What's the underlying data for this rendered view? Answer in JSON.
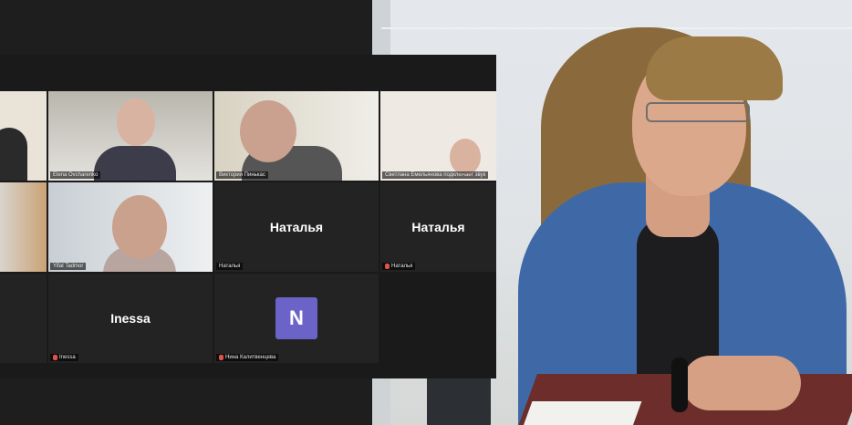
{
  "zoom": {
    "tiles": [
      {
        "id": "t0",
        "label": "",
        "kind": "video"
      },
      {
        "id": "t1",
        "label": "Elena Ovcharenko",
        "kind": "video"
      },
      {
        "id": "t2",
        "label": "Виктория Пинькас",
        "kind": "video",
        "active": true
      },
      {
        "id": "t3",
        "label": "Светлана Емельянова подключает звук",
        "kind": "video"
      },
      {
        "id": "t4",
        "label": "",
        "kind": "video"
      },
      {
        "id": "t5",
        "label": "Yifat Tadmor",
        "kind": "video"
      },
      {
        "id": "t6",
        "name": "Наталья",
        "label": "Наталья",
        "kind": "name",
        "muted": false
      },
      {
        "id": "t7",
        "name": "Наталья",
        "label": "Наталья",
        "kind": "name",
        "muted": true
      },
      {
        "id": "t8",
        "label": "",
        "kind": "empty"
      },
      {
        "id": "t9",
        "name": "Inessa",
        "label": "Inessa",
        "kind": "name",
        "muted": true
      },
      {
        "id": "t10",
        "avatar": "N",
        "label": "Нина Калитвенцева",
        "kind": "avatar",
        "muted": true
      }
    ]
  },
  "colors": {
    "active_border": "#d9d96a",
    "avatar_bg": "#6c63c8",
    "mic_muted": "#e0524a"
  }
}
